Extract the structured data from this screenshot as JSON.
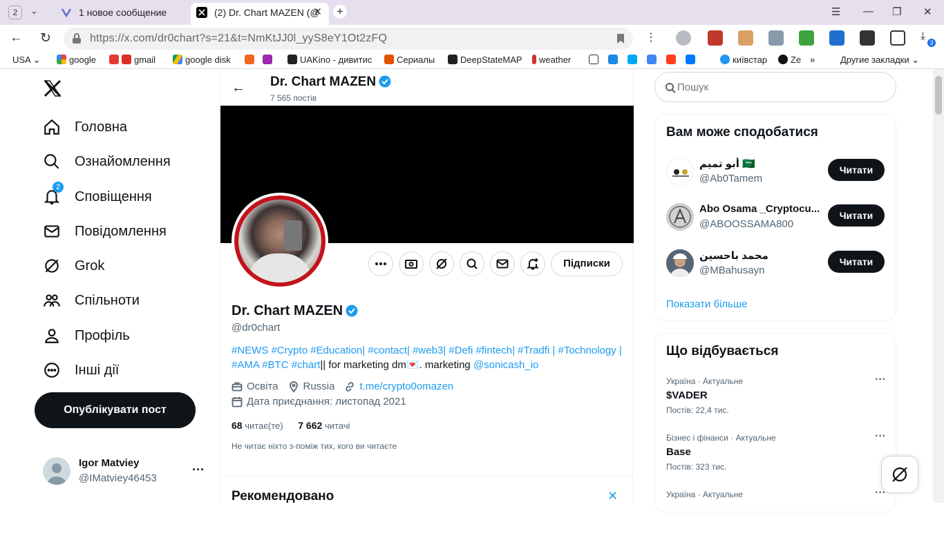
{
  "browser": {
    "tab_count": "2",
    "tabs": [
      {
        "title": "1 новое сообщение"
      },
      {
        "title": "(2) Dr. Chart MAZEN (@"
      }
    ],
    "url": "https://x.com/dr0chart?s=21&t=NmKtJJ0l_yyS8eY1Ot2zFQ",
    "download_badge": "3",
    "bookmarks": [
      "USA",
      "google",
      "gmail",
      "google disk",
      "UAKino - дивитис",
      "Сериалы",
      "DeepStateMAP",
      "weather",
      "київстар",
      "Ze",
      "»",
      "Другие закладки"
    ]
  },
  "nav": {
    "items": [
      {
        "label": "Головна",
        "icon": "home-icon"
      },
      {
        "label": "Ознайомлення",
        "icon": "search-icon"
      },
      {
        "label": "Сповіщення",
        "icon": "bell-icon"
      },
      {
        "label": "Повідомлення",
        "icon": "mail-icon"
      },
      {
        "label": "Grok",
        "icon": "grok-icon"
      },
      {
        "label": "Спільноти",
        "icon": "communities-icon"
      },
      {
        "label": "Профіль",
        "icon": "profile-icon"
      },
      {
        "label": "Інші дії",
        "icon": "more-icon"
      }
    ],
    "notification_badge": "2",
    "post_button": "Опублікувати пост",
    "account": {
      "name": "Igor Matviey",
      "handle": "@IMatviey46453"
    }
  },
  "profile": {
    "header_name": "Dr. Chart MAZEN",
    "post_count": "7 565 постів",
    "name": "Dr. Chart MAZEN",
    "handle": "@dr0chart",
    "bio_line1": "#NEWS #Crypto #Education| #contact| #web3| #Defi #fintech| #Tradfi | #Tochnology |",
    "bio_line2_links": "#AMA #BTC #chart",
    "bio_line2_text": "|| for marketing dm💌. marketing ",
    "bio_line2_mention": "@sonicash_io",
    "category": "Освіта",
    "location": "Russia",
    "website": "t.me/crypto0omazen",
    "joined": "Дата приєднання: листопад 2021",
    "following_count": "68",
    "following_label": "читає(те)",
    "followers_count": "7 662",
    "followers_label": "читачі",
    "no_mutual": "Не читає ніхто з-поміж тих, кого ви читаєте",
    "subscribed_button": "Підписки",
    "recommended": "Рекомендовано"
  },
  "sidebar": {
    "search_placeholder": "Пошук",
    "who_to_follow_title": "Вам може сподобатися",
    "suggestions": [
      {
        "name": "أبو تميم 🇸🇦",
        "handle": "@Ab0Tamem",
        "button": "Читати"
      },
      {
        "name": "Abo Osama _Cryptocu...",
        "handle": "@ABOOSSAMA800",
        "button": "Читати"
      },
      {
        "name": "محمد باحسين",
        "handle": "@MBahusayn",
        "button": "Читати"
      }
    ],
    "show_more": "Показати більше",
    "trends_title": "Що відбувається",
    "trends": [
      {
        "category": "Україна · Актуальне",
        "name": "$VADER",
        "posts": "Постів: 22,4 тис."
      },
      {
        "category": "Бізнес і фінанси · Актуальне",
        "name": "Base",
        "posts": "Постів: 323 тис."
      },
      {
        "category": "Україна · Актуальне",
        "name": "",
        "posts": ""
      }
    ]
  },
  "colors": {
    "accent": "#1d9bf0",
    "text": "#0f1419",
    "muted": "#536471",
    "profile_ring": "#c3131c"
  }
}
